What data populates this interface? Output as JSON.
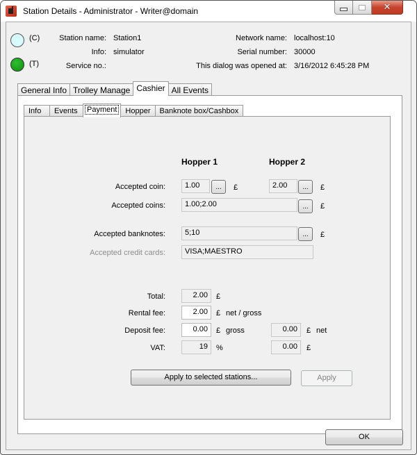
{
  "window": {
    "title": "Station Details - Administrator - Writer@domain",
    "controls": {
      "minimize": "minimize",
      "maximize": "maximize",
      "close": "✕"
    }
  },
  "status": {
    "c_tag": "(C)",
    "t_tag": "(T)",
    "c_color": "#d7fafc",
    "t_color": "#1aa51a"
  },
  "info": {
    "station_name_label": "Station name:",
    "station_name": "Station1",
    "info_label": "Info:",
    "info": "simulator",
    "service_no_label": "Service no.:",
    "service_no": "",
    "network_name_label": "Network name:",
    "network_name": "localhost:10",
    "serial_number_label": "Serial number:",
    "serial_number": "30000",
    "opened_at_label": "This dialog was opened at:",
    "opened_at": "3/16/2012 6:45:28 PM"
  },
  "outer_tabs": [
    {
      "label": "General Info",
      "active": false
    },
    {
      "label": "Trolley Manage",
      "active": false
    },
    {
      "label": "Cashier",
      "active": true
    },
    {
      "label": "All Events",
      "active": false
    }
  ],
  "inner_tabs": [
    {
      "label": "Info",
      "active": false
    },
    {
      "label": "Events",
      "active": false
    },
    {
      "label": "Payment",
      "active": true
    },
    {
      "label": "Hopper",
      "active": false
    },
    {
      "label": "Banknote box/Cashbox",
      "active": false
    }
  ],
  "payment": {
    "hopper1_header": "Hopper 1",
    "hopper2_header": "Hopper 2",
    "accepted_coin_label": "Accepted coin:",
    "hopper1_coin": "1.00",
    "hopper2_coin": "2.00",
    "accepted_coins_label": "Accepted coins:",
    "accepted_coins": "1.00;2.00",
    "accepted_banknotes_label": "Accepted banknotes:",
    "accepted_banknotes": "5;10",
    "accepted_credit_cards_label": "Accepted credit cards:",
    "accepted_credit_cards": "VISA;MAESTRO",
    "browse_label": "...",
    "currency": "£",
    "total_label": "Total:",
    "total": "2.00",
    "rental_fee_label": "Rental fee:",
    "rental_fee": "2.00",
    "rental_fee_suffix": "net / gross",
    "deposit_fee_label": "Deposit fee:",
    "deposit_fee": "0.00",
    "deposit_fee_suffix": "gross",
    "deposit_fee_net": "0.00",
    "deposit_fee_net_suffix": "net",
    "vat_label": "VAT:",
    "vat": "19",
    "vat_unit": "%",
    "vat_amount": "0.00",
    "apply_selected_label": "Apply to selected stations...",
    "apply_label": "Apply"
  },
  "footer": {
    "ok_label": "OK"
  }
}
